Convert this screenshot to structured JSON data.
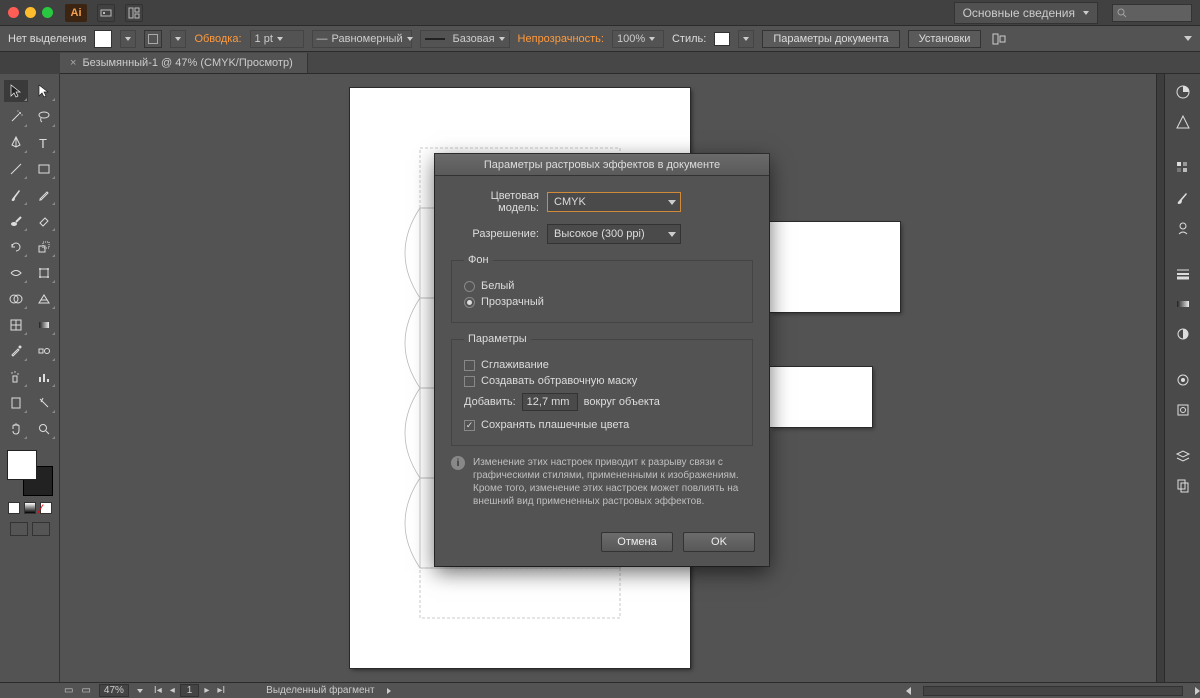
{
  "titlebar": {
    "workspace_label": "Основные сведения"
  },
  "ctrl": {
    "no_selection": "Нет выделения",
    "stroke_label": "Обводка:",
    "stroke_val": "1 pt",
    "dash_label": "Равномерный",
    "profile_label": "Базовая",
    "opacity_label": "Непрозрачность:",
    "opacity_val": "100%",
    "style_label": "Стиль:",
    "doc_params": "Параметры документа",
    "presets": "Установки"
  },
  "doc_tab": "Безымянный-1 @ 47% (CMYK/Просмотр)",
  "status": {
    "zoom": "47%",
    "page": "1",
    "fragment": "Выделенный фрагмент"
  },
  "dialog": {
    "title": "Параметры растровых эффектов в документе",
    "color_model_label": "Цветовая модель:",
    "color_model_value": "CMYK",
    "resolution_label": "Разрешение:",
    "resolution_value": "Высокое (300 ppi)",
    "bg_legend": "Фон",
    "bg_white": "Белый",
    "bg_transparent": "Прозрачный",
    "params_legend": "Параметры",
    "antialias": "Сглаживание",
    "clipmask": "Создавать обтравочную маску",
    "add_label": "Добавить:",
    "add_value": "12,7 mm",
    "add_suffix": "вокруг объекта",
    "preserve_spot": "Сохранять плашечные цвета",
    "info_text": "Изменение этих настроек приводит к разрыву связи с графическими стилями, примененными к изображениям. Кроме того, изменение этих настроек может повлиять на внешний вид примененных растровых эффектов.",
    "cancel": "Отмена",
    "ok": "OK"
  }
}
